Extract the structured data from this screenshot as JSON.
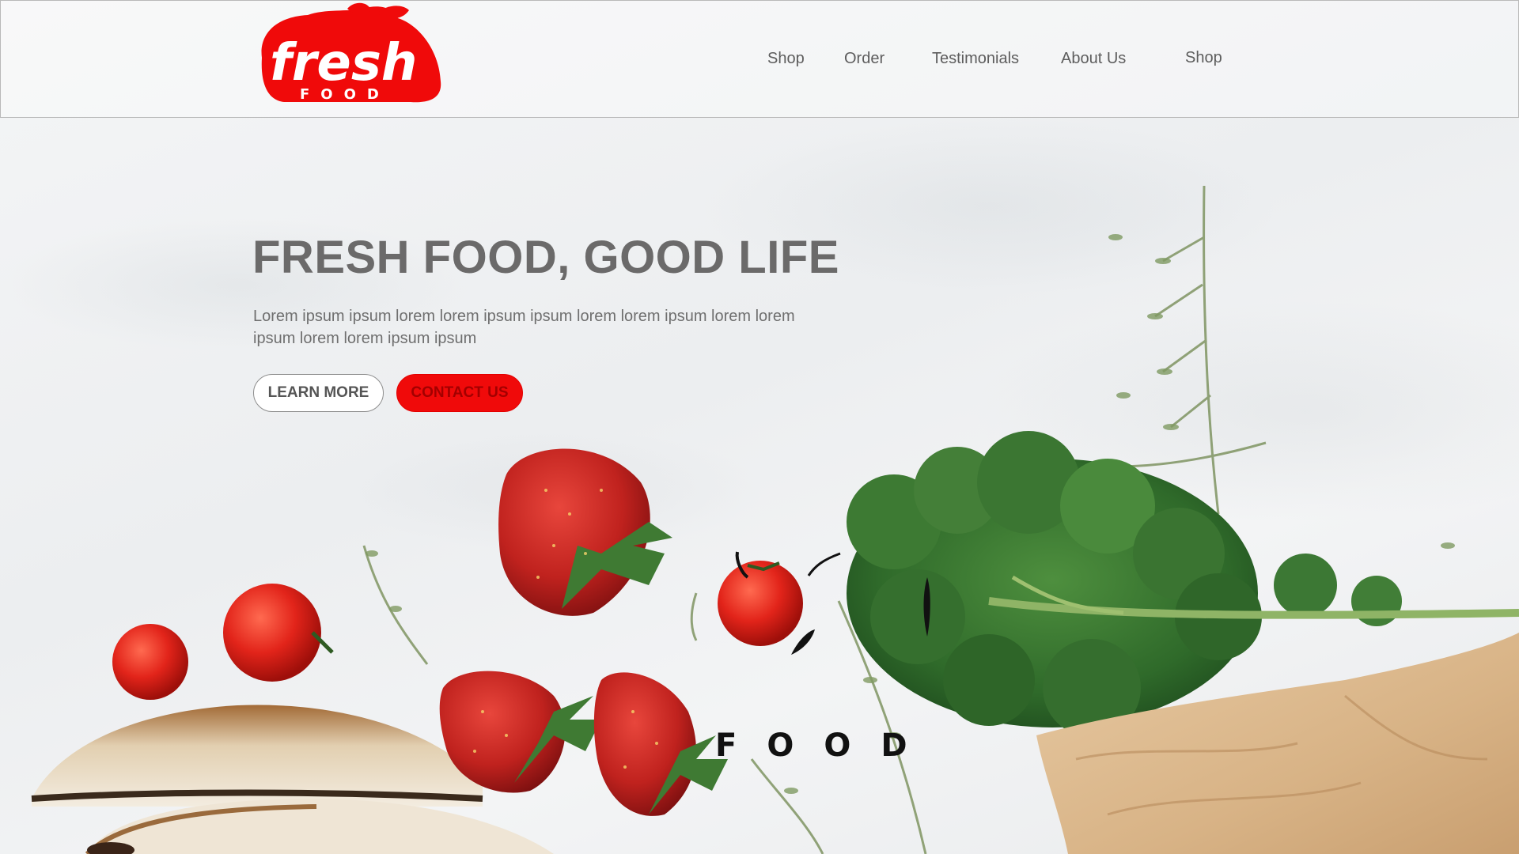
{
  "brand": {
    "logo_main": "fresh",
    "logo_sub": "FOOD",
    "accent_color": "#f00a0a"
  },
  "nav": {
    "items": [
      {
        "label": "Shop"
      },
      {
        "label": "Order"
      },
      {
        "label": "Testimonials"
      },
      {
        "label": "About Us"
      },
      {
        "label": "Shop"
      }
    ]
  },
  "hero": {
    "title": "FRESH FOOD, GOOD LIFE",
    "text": "Lorem ipsum ipsum lorem lorem ipsum ipsum lorem lorem ipsum lorem lorem ipsum lorem lorem ipsum ipsum",
    "learn_more_label": "LEARN MORE",
    "contact_label": "CONTACT US"
  },
  "decor": {
    "overlay_letters": "FOOD"
  }
}
